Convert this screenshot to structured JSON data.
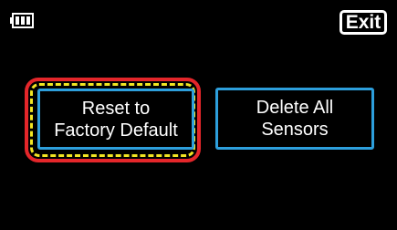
{
  "status_bar": {
    "battery_icon": "battery-icon",
    "battery_level": 1.0
  },
  "header": {
    "exit_label": "Exit"
  },
  "menu": {
    "buttons": [
      {
        "line1": "Reset to",
        "line2": "Factory Default",
        "selected": true
      },
      {
        "line1": "Delete All",
        "line2": "Sensors",
        "selected": false
      }
    ]
  },
  "colors": {
    "background": "#000000",
    "button_border": "#2d9fdc",
    "focus_outer": "#e4262a",
    "focus_dash": "#f2e522",
    "text": "#ffffff"
  }
}
